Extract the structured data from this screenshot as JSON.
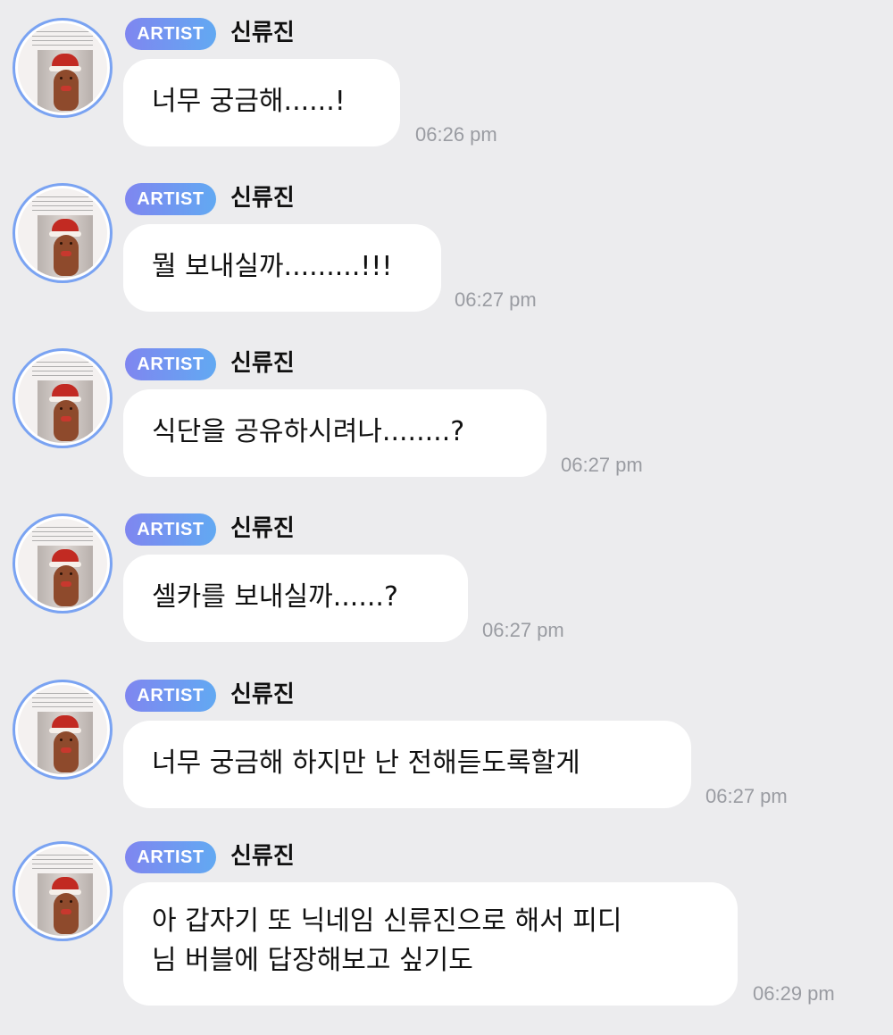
{
  "badge_label": "ARTIST",
  "sender": "신류진",
  "messages": [
    {
      "text": "너무 궁금해......!",
      "time": "06:26 pm"
    },
    {
      "text": "뭘 보내실까.........!!!",
      "time": "06:27 pm"
    },
    {
      "text": "식단을 공유하시려나........?",
      "time": "06:27 pm"
    },
    {
      "text": "셀카를 보내실까......?",
      "time": "06:27 pm"
    },
    {
      "text": "너무 궁금해 하지만 난 전해듣도록할게",
      "time": "06:27 pm"
    },
    {
      "text": "아 갑자기 또 닉네임 신류진으로 해서 피디\n님 버블에 답장해보고 싶기도",
      "time": "06:29 pm"
    }
  ],
  "colors": {
    "background": "#ececee",
    "bubble": "#ffffff",
    "badge_gradient_start": "#7f86f0",
    "badge_gradient_end": "#62a9f2",
    "avatar_ring": "#7aa3f2",
    "timestamp": "#9a9ca2"
  },
  "icons": {
    "avatar": "profile-photo-gingerbread-santa"
  }
}
